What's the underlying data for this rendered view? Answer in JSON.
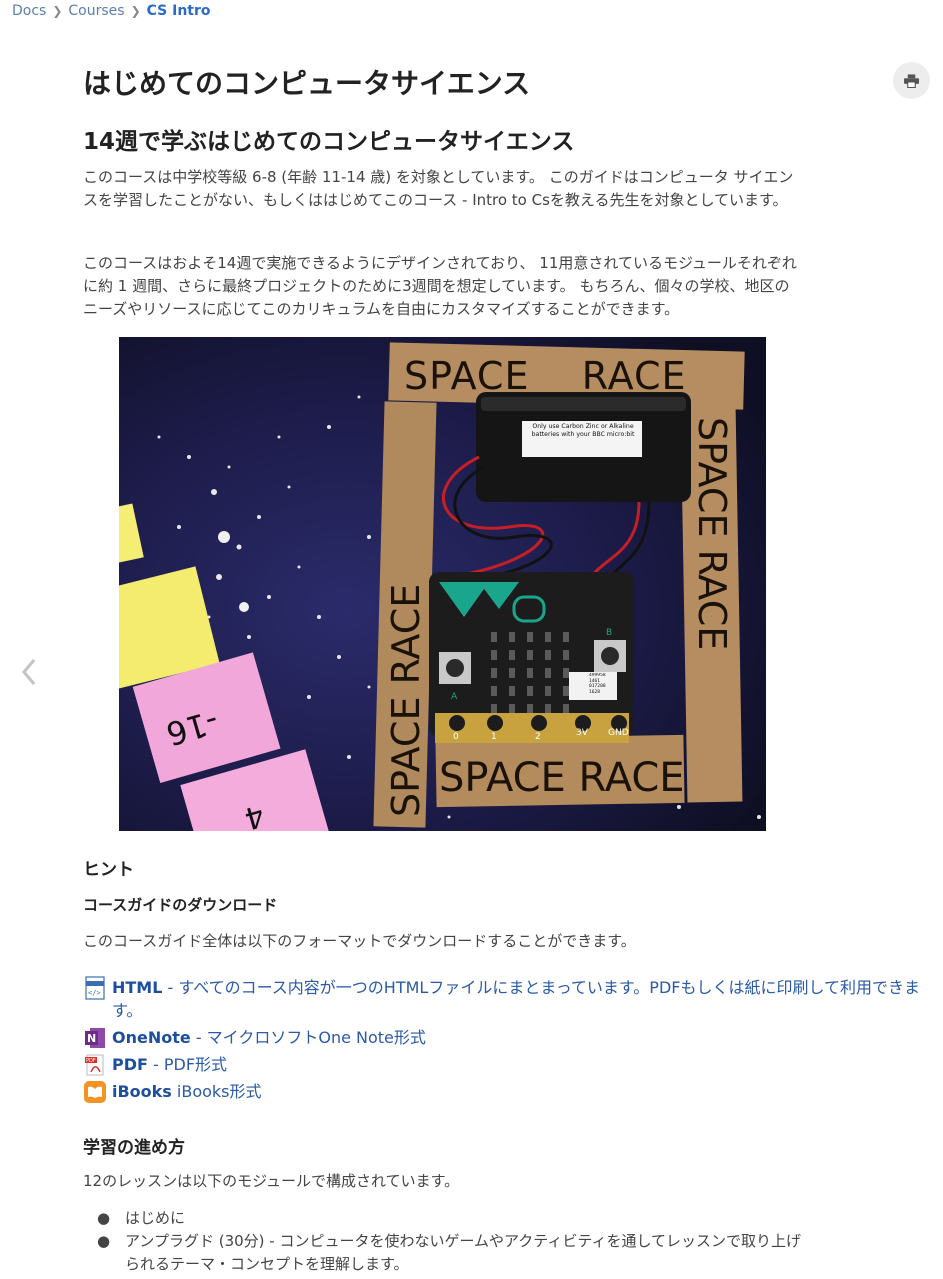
{
  "breadcrumb": [
    {
      "label": "Docs"
    },
    {
      "label": "Courses"
    },
    {
      "label": "CS Intro"
    }
  ],
  "title": "はじめてのコンピュータサイエンス",
  "subtitle": "14週で学ぶはじめてのコンピュータサイエンス",
  "paragraphs": {
    "p1": "このコースは中学校等級 6-8 (年齢 11-14 歳) を対象としています。 このガイドはコンピュータ サイエンスを学習したことがない、もしくははじめてこのコース - Intro to Csを教える先生を対象としています。",
    "p2": "このコースはおよそ14週で実施できるようにデザインされており、 11用意されているモジュールそれぞれに約 1 週間、さらに最終プロジェクトのために3週間を想定しています。 もちろん、個々の学校、地区のニーズやリソースに応じてこのカリキュラムを自由にカスタマイズすることができます。"
  },
  "image": {
    "board_top": "SPACE    RACE",
    "board_bottom": "SPACE RACE",
    "board_left": "SPACE RACE",
    "board_right": "SPACE RACE",
    "battery_label": "Only use Carbon Zinc or Alkaline batteries with your BBC micro:bit",
    "pins": [
      "0",
      "1",
      "2",
      "3V",
      "GND"
    ],
    "button_a": "A",
    "button_b": "B",
    "serial": "499958\n1461\n017208\n1628",
    "card_pink1": "-16",
    "card_pink2": "4",
    "colors": {
      "space": "#1e1d4a",
      "cardboard": "#b48c5e",
      "yellow": "#f5ee74",
      "pink": "#f0a6d8",
      "board": "#1b1b1b",
      "teal": "#1aa68c"
    }
  },
  "hints_heading": "ヒント",
  "download_heading": "コースガイドのダウンロード",
  "download_intro": "このコースガイド全体は以下のフォーマットでダウンロードすることができます。",
  "downloads": [
    {
      "name": "HTML",
      "desc": " - すべてのコース内容が一つのHTMLファイルにまとまっています。PDFもしくは紙に印刷して利用できます。",
      "icon": "html-file-icon"
    },
    {
      "name": "OneNote",
      "desc": " - マイクロソフトOne Note形式",
      "icon": "onenote-icon"
    },
    {
      "name": "PDF",
      "desc": " - PDF形式",
      "icon": "pdf-icon"
    },
    {
      "name": "iBooks",
      "desc": " iBooks形式",
      "icon": "ibooks-icon"
    }
  ],
  "progress_heading": "学習の進め方",
  "progress_intro": "12のレッスンは以下のモジュールで構成されています。",
  "bullets": [
    "はじめに",
    "アンプラグド (30分) - コンピュータを使わないゲームやアクティビティを通してレッスンで取り上げられるテーマ・コンセプトを理解します。"
  ],
  "print_icon": "printer-icon",
  "prev_icon": "chevron-left-icon"
}
